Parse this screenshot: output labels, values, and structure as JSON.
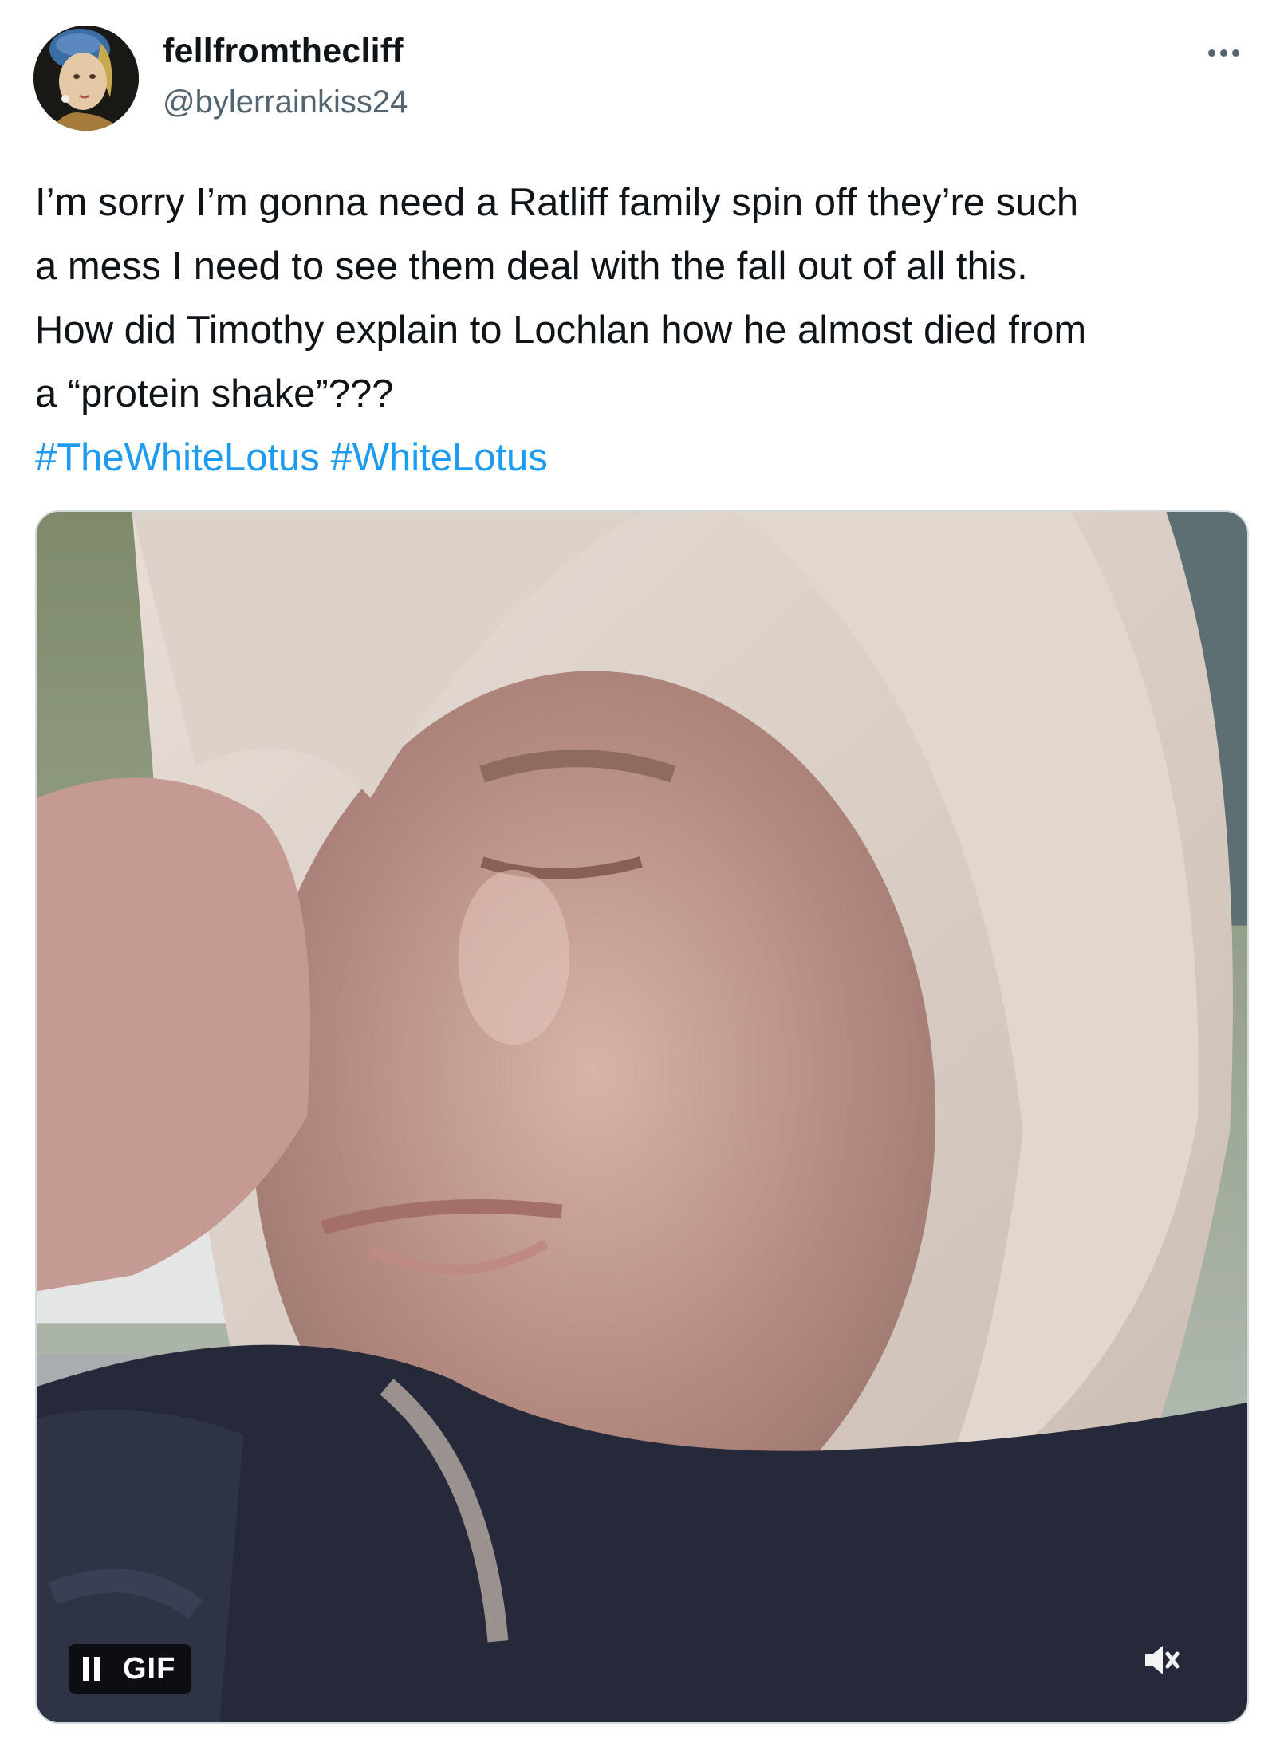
{
  "author": {
    "display_name": "fellfromthecliff",
    "handle": "@bylerrainkiss24",
    "avatar": "girl-with-a-pearl-earring-avatar"
  },
  "menu": {
    "icon": "more-horizontal-icon"
  },
  "tweet": {
    "text_lines": [
      "I’m sorry I’m gonna need a Ratliff family spin off they’re such",
      "a mess I need to see them deal with the fall out of all this.",
      "How did Timothy explain to Lochlan how he almost died from",
      "a “protein shake”???"
    ],
    "hashtags": [
      "#TheWhiteLotus",
      "#WhiteLotus"
    ]
  },
  "media": {
    "type": "gif",
    "badge_label": "GIF",
    "pause_icon": "pause-icon",
    "mute_icon": "speaker-muted-icon"
  },
  "colors": {
    "text_primary": "#0f1419",
    "text_secondary": "#536471",
    "hashtag": "#1d9bf0",
    "border": "#cfd9de"
  }
}
